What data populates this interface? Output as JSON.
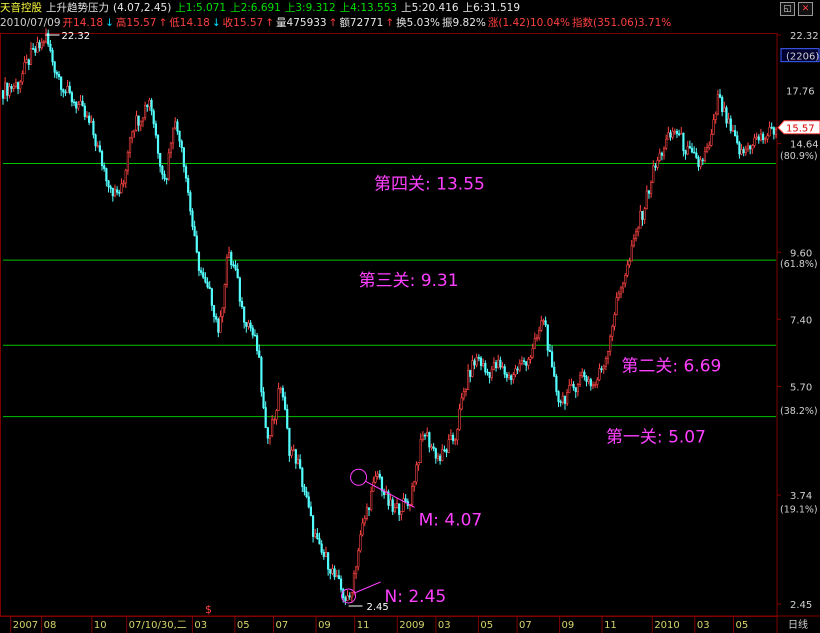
{
  "header": {
    "stock_name": "天音控股",
    "indicator": "上升趋势压力",
    "params": "(4.07,2.45)",
    "levels": [
      {
        "label": "上1:5.071",
        "color": "#00e000"
      },
      {
        "label": "上2:6.691",
        "color": "#00e000"
      },
      {
        "label": "上3:9.312",
        "color": "#00e000"
      },
      {
        "label": "上4:13.553",
        "color": "#00e000"
      },
      {
        "label": "上5:20.416",
        "color": "#e8e8e8"
      },
      {
        "label": "上6:31.519",
        "color": "#e8e8e8"
      }
    ],
    "quote": [
      {
        "label": "2010/07/09",
        "color": "#cfcfcf"
      },
      {
        "label": "开14.18",
        "color": "#ff4040"
      },
      {
        "label": "↓",
        "color": "#00e0ff"
      },
      {
        "label": "高15.57",
        "color": "#ff4040"
      },
      {
        "label": "↑",
        "color": "#ff4040"
      },
      {
        "label": "低14.18",
        "color": "#ff4040"
      },
      {
        "label": "↓",
        "color": "#00e0ff"
      },
      {
        "label": "收15.57",
        "color": "#ff4040"
      },
      {
        "label": "↑",
        "color": "#ff4040"
      },
      {
        "label": "量475933",
        "color": "#e8e8e8"
      },
      {
        "label": "↑",
        "color": "#ff4040"
      },
      {
        "label": "额72771",
        "color": "#e8e8e8"
      },
      {
        "label": "↑",
        "color": "#ff4040"
      },
      {
        "label": "换5.03%",
        "color": "#e8e8e8"
      },
      {
        "label": "振9.82%",
        "color": "#e8e8e8"
      },
      {
        "label": "涨(1.42)10.04%",
        "color": "#ff4040"
      },
      {
        "label": "指数(351.06)3.71%",
        "color": "#ff4040"
      }
    ]
  },
  "colors": {
    "background": "#000000",
    "up": "#ff4444",
    "down": "#54ffff",
    "level_line": "#00c000",
    "annotation": "#ff40ff",
    "axis_text": "#d0d0d0",
    "month_text": "#d4d46a",
    "gridline": "#800000"
  },
  "icons": [
    "restore-icon",
    "close-icon"
  ],
  "chart_data": {
    "type": "candlestick",
    "title": "天音控股",
    "scale": "log",
    "ylim": [
      2.45,
      22.32
    ],
    "y_ticks": [
      22.32,
      14.64,
      9.6,
      7.4,
      5.7,
      3.74,
      2.45
    ],
    "y_tick_labels": [
      "22.32",
      "14.64",
      "9.60",
      "7.40",
      "5.70",
      "3.74",
      "2.45"
    ],
    "percent_labels": [
      {
        "value": 14.0,
        "label": "(80.9%)"
      },
      {
        "value": 9.2,
        "label": "(61.8%)"
      },
      {
        "value": 5.2,
        "label": "(38.2%)"
      },
      {
        "value": 3.55,
        "label": "(19.1%)"
      }
    ],
    "axis_badges": [
      {
        "value": 20.6,
        "label": "(2206)",
        "style": "box"
      },
      {
        "value": 18.0,
        "label": "17.76",
        "style": "plain"
      },
      {
        "value": 15.57,
        "label": "15.57",
        "style": "price"
      }
    ],
    "x_axis_labels": [
      "2007",
      "08",
      "10",
      "07/10/30,二",
      "03",
      "05",
      "07",
      "09",
      "11",
      "2009",
      "03",
      "05",
      "07",
      "09",
      "11",
      "2010",
      "03",
      "05"
    ],
    "x_axis_positions": [
      0.01,
      0.05,
      0.115,
      0.16,
      0.245,
      0.3,
      0.35,
      0.405,
      0.455,
      0.51,
      0.56,
      0.615,
      0.665,
      0.72,
      0.775,
      0.84,
      0.895,
      0.945
    ],
    "period_label": "日线",
    "horizontal_lines": [
      {
        "value": 13.553,
        "label": "第四关: 13.55"
      },
      {
        "value": 9.312,
        "label": "第三关: 9.31"
      },
      {
        "value": 6.691,
        "label": "第二关: 6.69"
      },
      {
        "value": 5.071,
        "label": "第一关: 5.07"
      }
    ],
    "annotations": [
      {
        "label": "M: 4.07",
        "value": 4.07,
        "x_frac": 0.46
      },
      {
        "label": "N: 2.45",
        "value": 2.45,
        "x_frac": 0.447
      },
      {
        "label": "22.32",
        "value": 22.32,
        "x_frac": 0.055
      },
      {
        "label": "2.45",
        "value": 2.45,
        "x_frac": 0.447
      }
    ],
    "close_path": [
      [
        0.0,
        18.0
      ],
      [
        0.02,
        18.5
      ],
      [
        0.035,
        20.5
      ],
      [
        0.05,
        21.5
      ],
      [
        0.055,
        22.3
      ],
      [
        0.065,
        20.0
      ],
      [
        0.08,
        18.0
      ],
      [
        0.1,
        16.8
      ],
      [
        0.115,
        15.5
      ],
      [
        0.125,
        14.0
      ],
      [
        0.135,
        12.8
      ],
      [
        0.145,
        12.0
      ],
      [
        0.155,
        12.3
      ],
      [
        0.165,
        15.5
      ],
      [
        0.18,
        16.5
      ],
      [
        0.19,
        17.5
      ],
      [
        0.2,
        14.5
      ],
      [
        0.21,
        12.5
      ],
      [
        0.22,
        16.0
      ],
      [
        0.23,
        15.0
      ],
      [
        0.24,
        12.0
      ],
      [
        0.25,
        9.5
      ],
      [
        0.26,
        8.5
      ],
      [
        0.27,
        8.0
      ],
      [
        0.28,
        7.0
      ],
      [
        0.29,
        9.5
      ],
      [
        0.3,
        9.0
      ],
      [
        0.31,
        7.6
      ],
      [
        0.32,
        7.2
      ],
      [
        0.33,
        6.5
      ],
      [
        0.34,
        4.7
      ],
      [
        0.35,
        5.0
      ],
      [
        0.36,
        5.8
      ],
      [
        0.37,
        4.5
      ],
      [
        0.38,
        4.3
      ],
      [
        0.39,
        3.8
      ],
      [
        0.4,
        3.3
      ],
      [
        0.41,
        3.0
      ],
      [
        0.42,
        2.9
      ],
      [
        0.43,
        2.7
      ],
      [
        0.44,
        2.55
      ],
      [
        0.447,
        2.45
      ],
      [
        0.455,
        2.8
      ],
      [
        0.465,
        3.3
      ],
      [
        0.475,
        3.7
      ],
      [
        0.485,
        4.07
      ],
      [
        0.495,
        3.7
      ],
      [
        0.505,
        3.5
      ],
      [
        0.515,
        3.6
      ],
      [
        0.525,
        3.6
      ],
      [
        0.535,
        4.2
      ],
      [
        0.545,
        4.8
      ],
      [
        0.555,
        4.5
      ],
      [
        0.565,
        4.3
      ],
      [
        0.575,
        4.5
      ],
      [
        0.585,
        4.7
      ],
      [
        0.595,
        5.5
      ],
      [
        0.605,
        6.1
      ],
      [
        0.615,
        6.4
      ],
      [
        0.625,
        6.0
      ],
      [
        0.64,
        6.2
      ],
      [
        0.655,
        5.9
      ],
      [
        0.67,
        6.2
      ],
      [
        0.685,
        6.5
      ],
      [
        0.7,
        7.5
      ],
      [
        0.71,
        6.0
      ],
      [
        0.72,
        5.4
      ],
      [
        0.735,
        5.6
      ],
      [
        0.75,
        6.0
      ],
      [
        0.765,
        5.7
      ],
      [
        0.78,
        6.4
      ],
      [
        0.79,
        7.5
      ],
      [
        0.8,
        8.5
      ],
      [
        0.81,
        9.2
      ],
      [
        0.82,
        10.5
      ],
      [
        0.83,
        11.5
      ],
      [
        0.84,
        13.0
      ],
      [
        0.855,
        14.5
      ],
      [
        0.87,
        15.5
      ],
      [
        0.885,
        14.2
      ],
      [
        0.9,
        13.5
      ],
      [
        0.915,
        14.5
      ],
      [
        0.925,
        17.5
      ],
      [
        0.94,
        15.5
      ],
      [
        0.955,
        14.0
      ],
      [
        0.97,
        14.8
      ],
      [
        0.985,
        15.0
      ],
      [
        1.0,
        15.57
      ]
    ]
  }
}
